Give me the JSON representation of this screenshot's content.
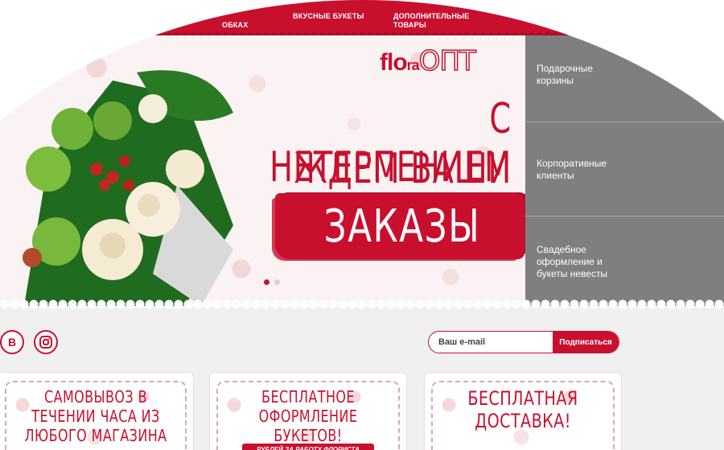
{
  "nav": {
    "items": [
      {
        "label": "ОБКАХ"
      },
      {
        "label": "ВКУСНЫЕ БУКЕТЫ"
      },
      {
        "label": "ДОПОЛНИТЕЛЬНЫЕ ТОВАРЫ"
      }
    ]
  },
  "logo": {
    "part1": "flo",
    "part2": "ra",
    "part3": "ОПТ"
  },
  "hero": {
    "line1": "С НЕТЕРПЕНИЕМ",
    "line2": "ЖДЕМ ВАШИ",
    "line3": "ЗАКАЗЫ"
  },
  "side_menu": {
    "items": [
      {
        "label": "Подарочные корзины"
      },
      {
        "label": "Корпоративные клиенты"
      },
      {
        "label": "Свадебное оформление и букеты невесты"
      }
    ]
  },
  "social": {
    "vk": "В"
  },
  "subscribe": {
    "placeholder": "Ваш e-mail",
    "button": "Подписаться"
  },
  "cards": [
    {
      "title": "САМОВЫВОЗ В ТЕЧЕНИИ ЧАСА ИЗ ЛЮБОГО МАГАЗИНА",
      "ribbon": ""
    },
    {
      "title": "БЕСПЛАТНОЕ ОФОРМЛЕНИЕ БУКЕТОВ!",
      "ribbon": "РУБЛЕЙ ЗА РАБОТУ ФЛОРИСТА"
    },
    {
      "title": "БЕСПЛАТНАЯ ДОСТАВКА!",
      "ribbon": ""
    }
  ],
  "colors": {
    "brand": "#c8102e",
    "side_menu": "#7f7f7f",
    "page_bg": "#f1f0f0"
  }
}
